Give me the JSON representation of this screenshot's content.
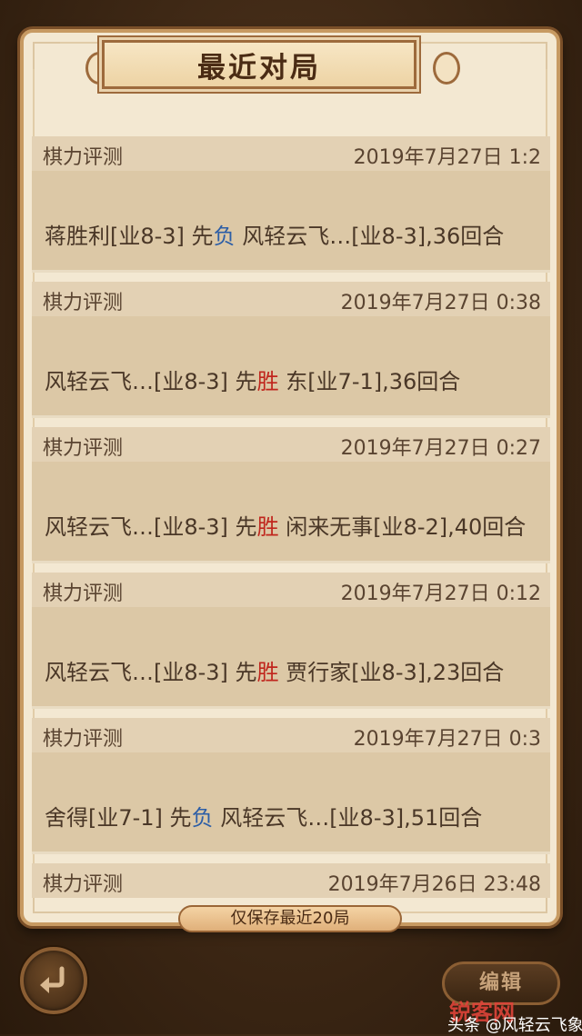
{
  "title": "最近对局",
  "records": [
    {
      "type": "棋力评测",
      "time": "2019年7月27日 1:2",
      "red": "蒋胜利[业8-3] 先",
      "result": "负",
      "result_kind": "lose",
      "black": " 风轻云飞…[业8-3],36回合"
    },
    {
      "type": "棋力评测",
      "time": "2019年7月27日 0:38",
      "red": "风轻云飞…[业8-3] 先",
      "result": "胜",
      "result_kind": "win",
      "black": " 东[业7-1],36回合"
    },
    {
      "type": "棋力评测",
      "time": "2019年7月27日 0:27",
      "red": "风轻云飞…[业8-3] 先",
      "result": "胜",
      "result_kind": "win",
      "black": " 闲来无事[业8-2],40回合"
    },
    {
      "type": "棋力评测",
      "time": "2019年7月27日 0:12",
      "red": "风轻云飞…[业8-3] 先",
      "result": "胜",
      "result_kind": "win",
      "black": " 贾行家[业8-3],23回合"
    },
    {
      "type": "棋力评测",
      "time": "2019年7月27日 0:3",
      "red": "舍得[业7-1] 先",
      "result": "负",
      "result_kind": "lose",
      "black": " 风轻云飞…[业8-3],51回合"
    },
    {
      "type": "棋力评测",
      "time": "2019年7月26日 23:48"
    }
  ],
  "footer_note": "仅保存最近20局",
  "edit_label": "编辑",
  "back_icon": "back-arrow-icon",
  "watermark": "锐客网",
  "source_tag": "头条 @风轻云飞象棋",
  "colors": {
    "win": "#c0261d",
    "lose": "#2d5ea6",
    "panel": "#f3e8d2",
    "frame": "#c79a62"
  }
}
